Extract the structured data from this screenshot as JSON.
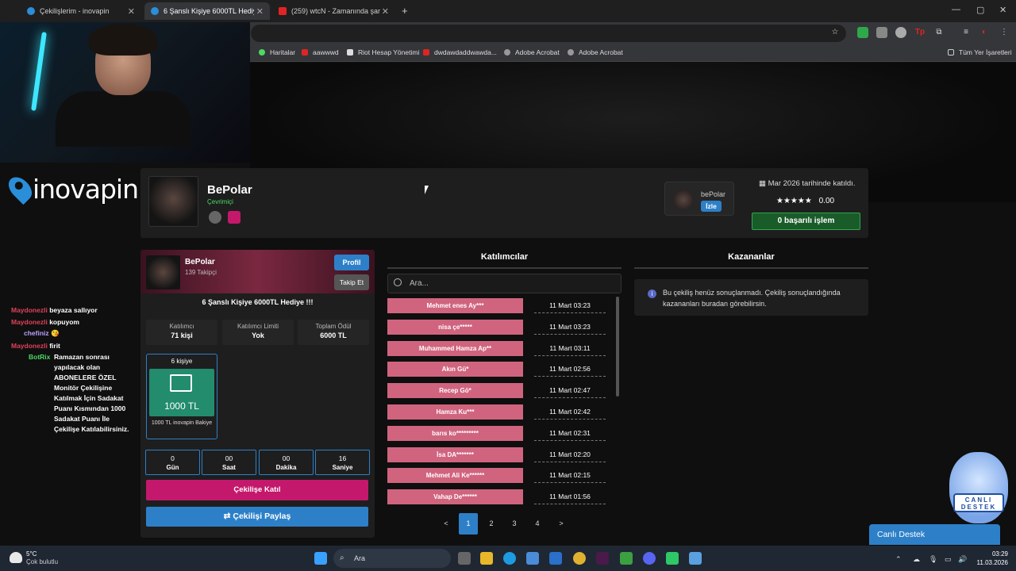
{
  "tabs": [
    {
      "title": "Çekilişlerim - inovapin",
      "icon_color": "#2a8ed8"
    },
    {
      "title": "6 Şanslı Kişiye 6000TL Hediye !!!",
      "icon_color": "#2a8ed8"
    },
    {
      "title": "(259) wtcN - Zamanında şarkısı",
      "icon_color": "#e02424"
    }
  ],
  "bookmarks": [
    "Haritalar",
    "aawwwd",
    "Riot Hesap Yönetimi",
    "dwdawdaddwawda...",
    "Adobe Acrobat",
    "Adobe Acrobat"
  ],
  "bookmarks_all": "Tüm Yer İşaretleri",
  "logo": "inovapin",
  "chat": [
    {
      "user": "Maydonezli",
      "msg": "beyaza sallıyor",
      "color": "#e0405a"
    },
    {
      "user": "Maydonezli",
      "msg": "kopuyom",
      "color": "#e0405a"
    },
    {
      "user": "chefiniz",
      "msg": "😘",
      "color": "#b9a3ff"
    },
    {
      "user": "Maydonezli",
      "msg": "firit",
      "color": "#e0405a"
    },
    {
      "user": "BotRix",
      "msg": "Ramazan sonrası yapılacak olan ABONELERE ÖZEL Monitör Çekilişine Katılmak İçin Sadakat Puanı Kısmından 1000 Sadakat Puanı İle Çekilişe Katılabilirsiniz.",
      "color": "#4cd964"
    }
  ],
  "profile": {
    "name": "BePolar",
    "status": "Çevrimiçi",
    "mini_name": "bePolar",
    "follow_label": "İzle",
    "joined": "Mar 2026 tarihinde katıldı.",
    "stars": "★★★★★",
    "rating": "0.00",
    "success": "0 başarılı işlem"
  },
  "card": {
    "name": "BePolar",
    "followers": "139 Takipçi",
    "profile_btn": "Profil",
    "follow_btn": "Takip Et",
    "title": "6 Şanslı Kişiye 6000TL Hediye !!!",
    "stats": [
      {
        "label": "Katılımcı",
        "value": "71 kişi"
      },
      {
        "label": "Katılımcı Limiti",
        "value": "Yok"
      },
      {
        "label": "Toplam Ödül",
        "value": "6000 TL"
      }
    ],
    "prize_people": "6 kişiye",
    "prize_amount": "1000 TL",
    "prize_desc": "1000 TL inovapin Bakiye",
    "countdown": [
      {
        "value": "0",
        "label": "Gün"
      },
      {
        "value": "00",
        "label": "Saat"
      },
      {
        "value": "00",
        "label": "Dakika"
      },
      {
        "value": "16",
        "label": "Saniye"
      }
    ],
    "join_btn": "Çekilişe Katıl",
    "share_btn": "Çekilişi Paylaş"
  },
  "participants": {
    "heading": "Katılımcılar",
    "search_placeholder": "Ara...",
    "rows": [
      {
        "name": "Mehmet enes Ay***",
        "time": "11 Mart 03:23"
      },
      {
        "name": "nisa çe*****",
        "time": "11 Mart 03:23"
      },
      {
        "name": "Muhammed Hamza Ap**",
        "time": "11 Mart 03:11"
      },
      {
        "name": "Akın Gü*",
        "time": "11 Mart 02:56"
      },
      {
        "name": "Recep Gö*",
        "time": "11 Mart 02:47"
      },
      {
        "name": "Hamza Ku***",
        "time": "11 Mart 02:42"
      },
      {
        "name": "barıs ko*********",
        "time": "11 Mart 02:31"
      },
      {
        "name": "İsa DA*******",
        "time": "11 Mart 02:20"
      },
      {
        "name": "Mehmet Ali Ke******",
        "time": "11 Mart 02:15"
      },
      {
        "name": "Vahap De******",
        "time": "11 Mart 01:56"
      }
    ],
    "pages": [
      "<",
      "1",
      "2",
      "3",
      "4",
      ">"
    ]
  },
  "winners": {
    "heading": "Kazananlar",
    "message": "Bu çekiliş henüz sonuçlanmadı. Çekiliş sonuçlandığında kazananları buradan görebilirsin."
  },
  "support": {
    "mascot_label": "CANLI DESTEK",
    "widget": "Canlı Destek"
  },
  "taskbar": {
    "temp": "5°C",
    "weather": "Çok bulutlu",
    "search": "Ara",
    "time": "03:29",
    "date": "11.03.2026"
  }
}
